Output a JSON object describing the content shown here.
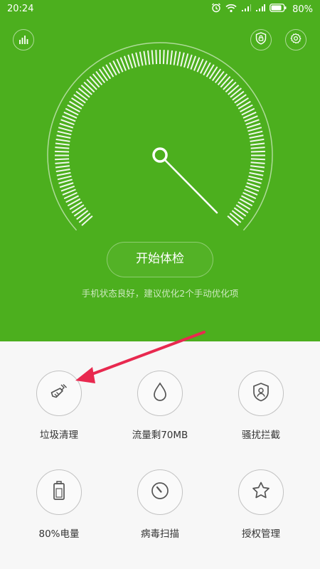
{
  "status_bar": {
    "time": "20:24",
    "battery": "80%"
  },
  "header": {
    "left_icon": "bar-chart-icon",
    "right_icons": [
      "shield-lock-icon",
      "gear-icon"
    ]
  },
  "scan": {
    "button_label": "开始体检",
    "status_text": "手机状态良好，建议优化2个手动优化项"
  },
  "features": [
    {
      "label": "垃圾清理",
      "icon": "broom-icon"
    },
    {
      "label": "流量剩70MB",
      "icon": "water-drop-icon"
    },
    {
      "label": "骚扰拦截",
      "icon": "shield-user-icon"
    },
    {
      "label": "80%电量",
      "icon": "battery-icon"
    },
    {
      "label": "病毒扫描",
      "icon": "scan-dial-icon"
    },
    {
      "label": "授权管理",
      "icon": "star-icon"
    }
  ],
  "colors": {
    "brand_green": "#4caf1e",
    "annotation_arrow": "#e8294f"
  }
}
